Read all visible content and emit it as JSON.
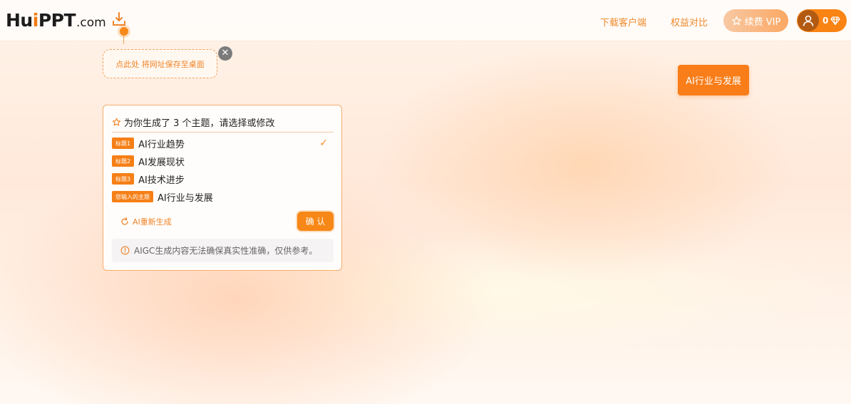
{
  "brand": {
    "logo_main_a": "Hu",
    "logo_main_dot": "i",
    "logo_main_b": "PPT",
    "logo_tld": ".com"
  },
  "header": {
    "nav": {
      "download": "下载客户端",
      "compare": "权益对比"
    },
    "vip_label": "续费 VIP",
    "coin_count": "0"
  },
  "save_tip": {
    "text": "点此处 将网址保存至桌面",
    "close": "✕"
  },
  "topic_tag": "AI行业与发展",
  "card": {
    "header": "为你生成了 3 个主题，请选择或修改",
    "topics": [
      {
        "badge": "标题1",
        "text": "AI行业趋势",
        "selected": true
      },
      {
        "badge": "标题2",
        "text": "AI发展现状",
        "selected": false
      },
      {
        "badge": "标题3",
        "text": "AI技术进步",
        "selected": false
      },
      {
        "badge": "您输入的主题",
        "text": "AI行业与发展",
        "selected": false
      }
    ],
    "check_mark": "✓",
    "regenerate": "AI重新生成",
    "confirm": "确 认",
    "notice": "AIGC生成内容无法确保真实性准确，仅供参考。"
  },
  "colors": {
    "accent": "#f78716",
    "text_dark": "#222222",
    "link": "#ee8a2c"
  }
}
